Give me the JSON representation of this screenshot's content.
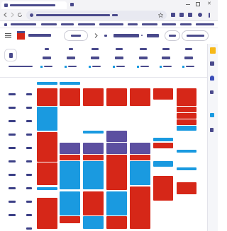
{
  "browser": {
    "tab_title": "",
    "url": ""
  },
  "app": {
    "today_button": "",
    "view_selector": ""
  },
  "colors": {
    "red": "#d62718",
    "blue": "#1a9ae0",
    "purple": "#5c4fa0",
    "accent_yellow": "#f6b818"
  },
  "icons": [
    "menu-icon",
    "calendar-logo-icon",
    "chevron-left-icon",
    "chevron-right-icon",
    "search-icon",
    "help-icon",
    "settings-icon",
    "apps-icon",
    "add-icon",
    "reload-icon",
    "back-icon",
    "forward-icon",
    "star-icon"
  ]
}
